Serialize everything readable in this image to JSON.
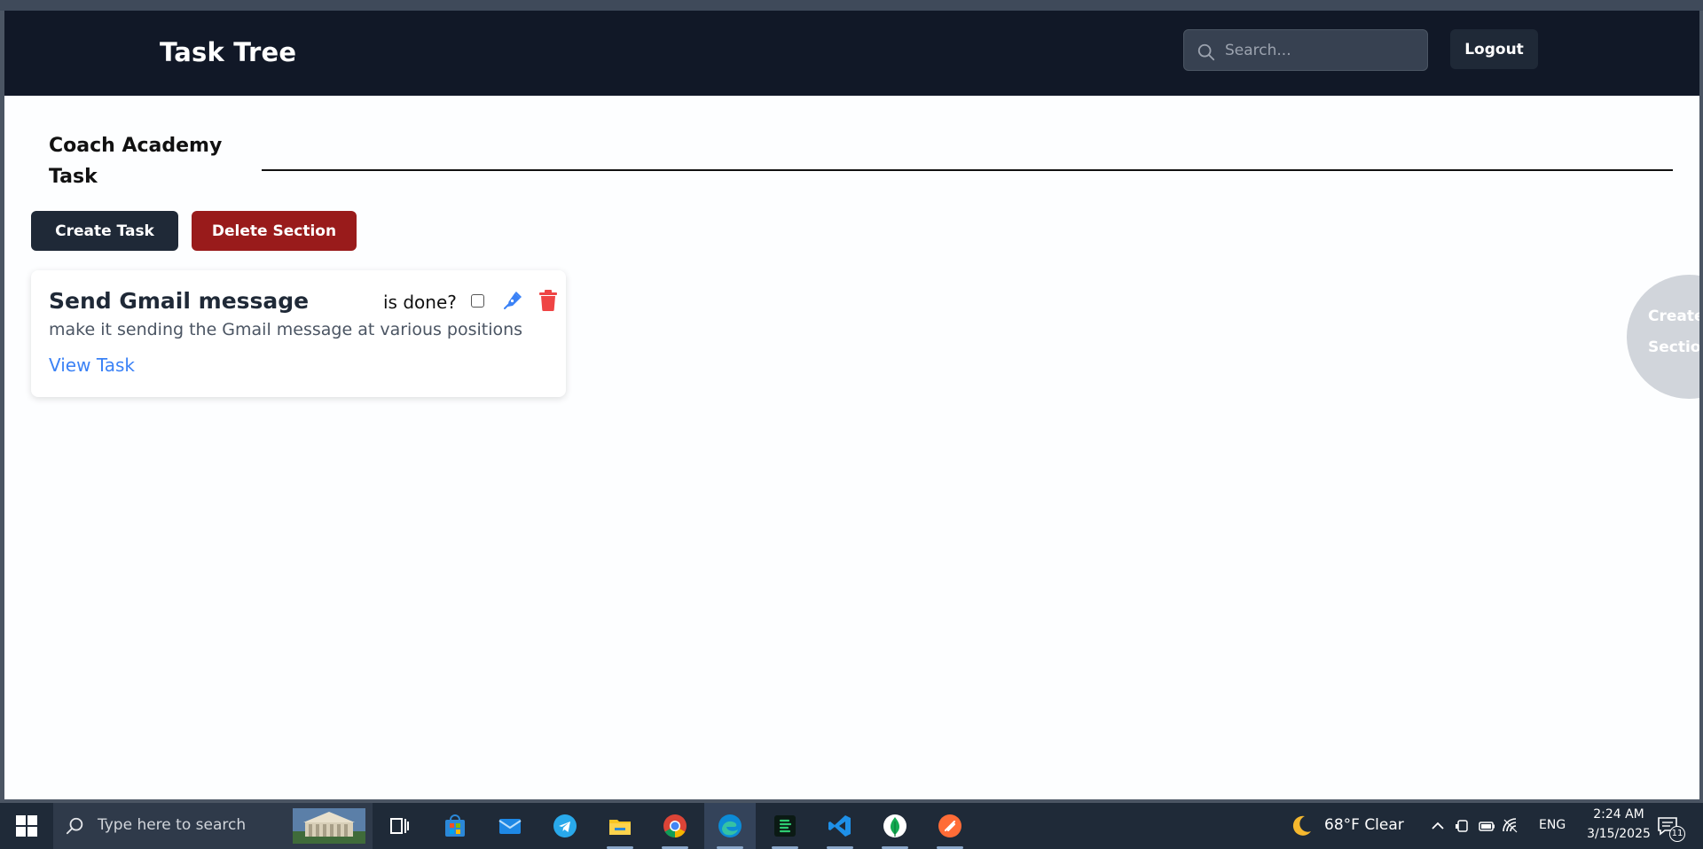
{
  "app": {
    "brand": "Task Tree",
    "search_placeholder": "Search...",
    "logout_label": "Logout"
  },
  "section": {
    "title": "Coach Academy Task",
    "create_task_label": "Create Task",
    "delete_section_label": "Delete Section"
  },
  "tasks": [
    {
      "title": "Send Gmail message",
      "done_label": "is done?",
      "done": false,
      "description": "make it sending the Gmail message at various positions",
      "link_label": "View Task"
    }
  ],
  "create_section_label": "Create Section",
  "colors": {
    "navbar": "#111827",
    "primary_button": "#1f2937",
    "danger_button": "#991b1b",
    "link": "#3b82f6",
    "edit_icon": "#3b82f6",
    "trash_icon": "#ef4444",
    "fab": "#d1d5db"
  },
  "taskbar": {
    "search_placeholder": "Type here to search",
    "apps": [
      "task-view-icon",
      "microsoft-store-icon",
      "mail-icon",
      "telegram-icon",
      "file-explorer-icon",
      "chrome-icon",
      "edge-icon",
      "code-editor-icon",
      "vscode-icon",
      "mongodb-compass-icon",
      "postman-icon"
    ],
    "weather": "68°F  Clear",
    "language": "ENG",
    "time": "2:24 AM",
    "date": "3/15/2025",
    "notification_count": "11"
  }
}
